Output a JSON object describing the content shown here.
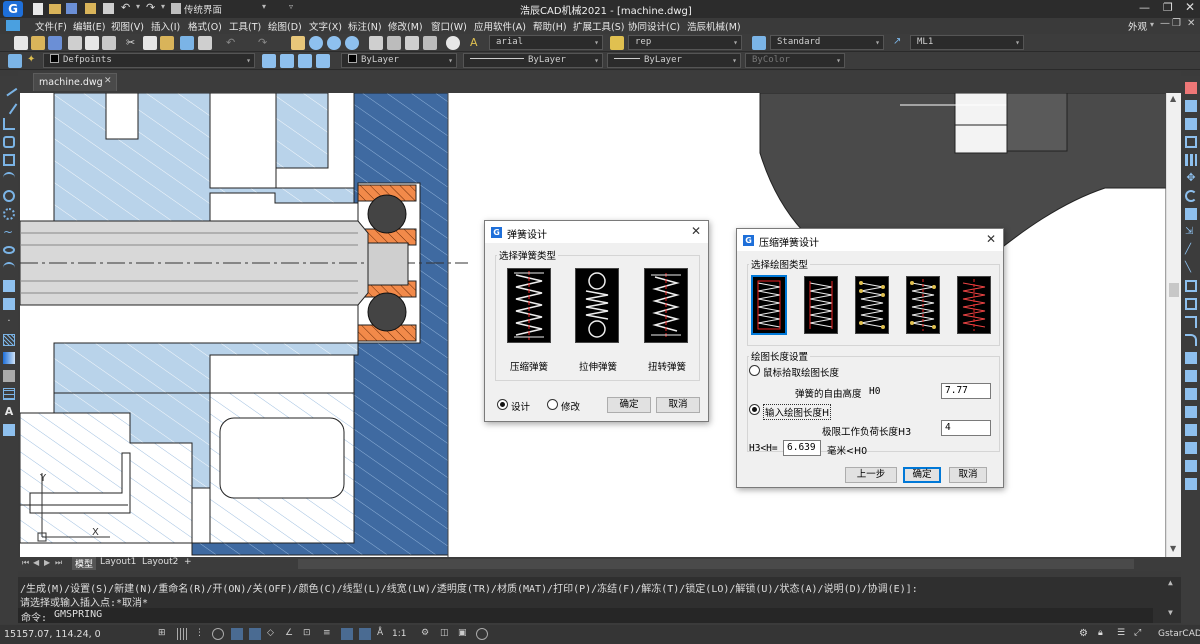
{
  "window": {
    "title": "浩辰CAD机械2021 - [machine.dwg]",
    "workspace": "传统界面",
    "right_label": "外观"
  },
  "menus": [
    "文件(F)",
    "编辑(E)",
    "视图(V)",
    "插入(I)",
    "格式(O)",
    "工具(T)",
    "绘图(D)",
    "文字(X)",
    "标注(N)",
    "修改(M)",
    "窗口(W)",
    "应用软件(A)",
    "帮助(H)",
    "扩展工具(S)",
    "协同设计(C)",
    "浩辰机械(M)"
  ],
  "toolbar": {
    "text_style": "arial",
    "dim_style": "rep",
    "table_style": "Standard",
    "mleader_style": "ML1",
    "layer": "Defpoints",
    "color": "ByLayer",
    "linetype": "ByLayer",
    "lineweight": "ByLayer",
    "plot_style": "ByColor"
  },
  "document_tab": "machine.dwg",
  "layout_tabs": [
    "模型",
    "Layout1",
    "Layout2",
    "+"
  ],
  "ucs": {
    "y_label": "Y",
    "x_label": "X"
  },
  "spring_dialog": {
    "title": "弹簧设计",
    "group_label": "选择弹簧类型",
    "types": [
      "压缩弹簧",
      "拉伸弹簧",
      "扭转弹簧"
    ],
    "mode_design": "设计",
    "mode_modify": "修改",
    "mode_selected": "设计",
    "ok": "确定",
    "cancel": "取消"
  },
  "compress_dialog": {
    "title": "压缩弹簧设计",
    "draw_type_label": "选择绘图类型",
    "length_group_label": "绘图长度设置",
    "option_mouse": "鼠标拾取绘图长度",
    "free_height_label": "弹簧的自由高度",
    "free_height_symbol": "H0",
    "free_height_value": "7.77",
    "option_input": "输入绘图长度H",
    "option_selected": "输入绘图长度H",
    "work_load_label": "极限工作负荷长度H3",
    "work_load_value": "4",
    "range_prefix": "H3<H=",
    "range_value": "6.639",
    "range_suffix": "毫米<H0",
    "prev": "上一步",
    "ok": "确定",
    "cancel": "取消"
  },
  "command_line": {
    "line1": "/生成(M)/设置(S)/新建(N)/重命名(R)/开(ON)/关(OFF)/颜色(C)/线型(L)/线宽(LW)/透明度(TR)/材质(MAT)/打印(P)/冻结(F)/解冻(T)/锁定(LO)/解锁(U)/状态(A)/说明(D)/协调(E)]:",
    "line2": "请选择或输入插入点:*取消*",
    "prompt": "命令:",
    "input": "GMSPRING"
  },
  "status": {
    "coords": "15157.07, 114.24, 0",
    "scale": "1:1",
    "app_name": "GstarCAD"
  },
  "colors": {
    "canvas_bg": "#ffffff",
    "hatch_light": "#b9d3ea",
    "hatch_dark": "#3f6aa1",
    "bearing_orange": "#f28a4a",
    "ui_dark": "#3c3c3c",
    "dialog_bg": "#f0f0f0",
    "accent": "#0078d7"
  }
}
